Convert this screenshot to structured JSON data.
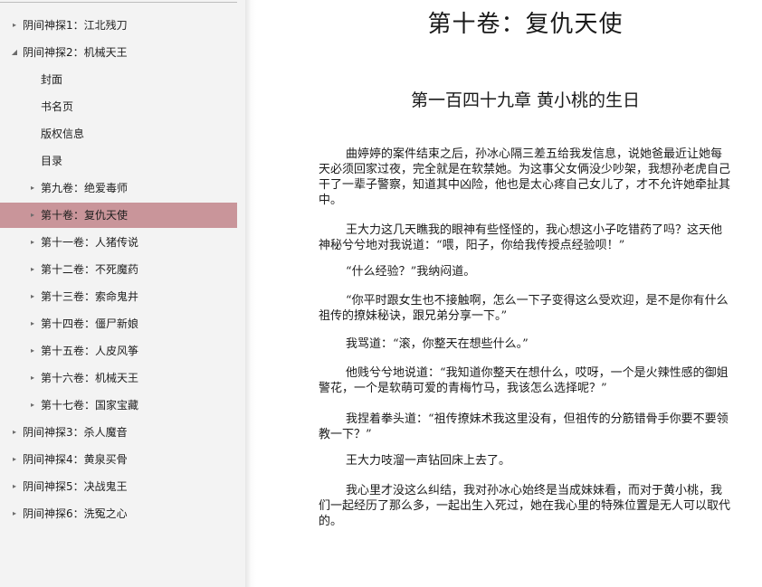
{
  "sidebar": {
    "items": [
      {
        "label": "阴间神探1：江北残刀",
        "arrow": "▸",
        "level": 0
      },
      {
        "label": "阴间神探2：机械天王",
        "arrow": "◢",
        "level": 0
      },
      {
        "label": "封面",
        "arrow": "",
        "level": 1
      },
      {
        "label": "书名页",
        "arrow": "",
        "level": 1
      },
      {
        "label": "版权信息",
        "arrow": "",
        "level": 1
      },
      {
        "label": "目录",
        "arrow": "",
        "level": 1
      },
      {
        "label": "第九卷：绝爱毒师",
        "arrow": "▸",
        "level": 1
      },
      {
        "label": "第十卷：复仇天使",
        "arrow": "▸",
        "level": 1,
        "selected": true
      },
      {
        "label": "第十一卷：人猪传说",
        "arrow": "▸",
        "level": 1
      },
      {
        "label": "第十二卷：不死魔药",
        "arrow": "▸",
        "level": 1
      },
      {
        "label": "第十三卷：索命鬼井",
        "arrow": "▸",
        "level": 1
      },
      {
        "label": "第十四卷：僵尸新娘",
        "arrow": "▸",
        "level": 1
      },
      {
        "label": "第十五卷：人皮风筝",
        "arrow": "▸",
        "level": 1
      },
      {
        "label": "第十六卷：机械天王",
        "arrow": "▸",
        "level": 1
      },
      {
        "label": "第十七卷：国家宝藏",
        "arrow": "▸",
        "level": 1
      },
      {
        "label": "阴间神探3：杀人魔音",
        "arrow": "▸",
        "level": 0
      },
      {
        "label": "阴间神探4：黄泉买骨",
        "arrow": "▸",
        "level": 0
      },
      {
        "label": "阴间神探5：决战鬼王",
        "arrow": "▸",
        "level": 0
      },
      {
        "label": "阴间神探6：洗冤之心",
        "arrow": "▸",
        "level": 0
      }
    ]
  },
  "content": {
    "volume_title": "第十卷：复仇天使",
    "chapter_title": "第一百四十九章 黄小桃的生日",
    "paragraphs": [
      "曲婷婷的案件结束之后，孙冰心隔三差五给我发信息，说她爸最近让她每天必须回家过夜，完全就是在软禁她。为这事父女俩没少吵架，我想孙老虎自己干了一辈子警察，知道其中凶险，他也是太心疼自己女儿了，才不允许她牵扯其中。",
      "王大力这几天瞧我的眼神有些怪怪的，我心想这小子吃错药了吗？这天他神秘兮兮地对我说道：“喂，阳子，你给我传授点经验呗！”",
      "“什么经验？”我纳闷道。",
      "“你平时跟女生也不接触啊，怎么一下子变得这么受欢迎，是不是你有什么祖传的撩妹秘诀，跟兄弟分享一下。”",
      "我骂道：“滚，你整天在想些什么。”",
      "他贱兮兮地说道：“我知道你整天在想什么，哎呀，一个是火辣性感的御姐警花，一个是软萌可爱的青梅竹马，我该怎么选择呢？”",
      "我捏着拳头道：“祖传撩妹术我这里没有，但祖传的分筋错骨手你要不要领教一下？”",
      "王大力吱溜一声钻回床上去了。",
      "我心里才没这么纠结，我对孙冰心始终是当成妹妹看，而对于黄小桃，我们一起经历了那么多，一起出生入死过，她在我心里的特殊位置是无人可以取代的。"
    ]
  }
}
